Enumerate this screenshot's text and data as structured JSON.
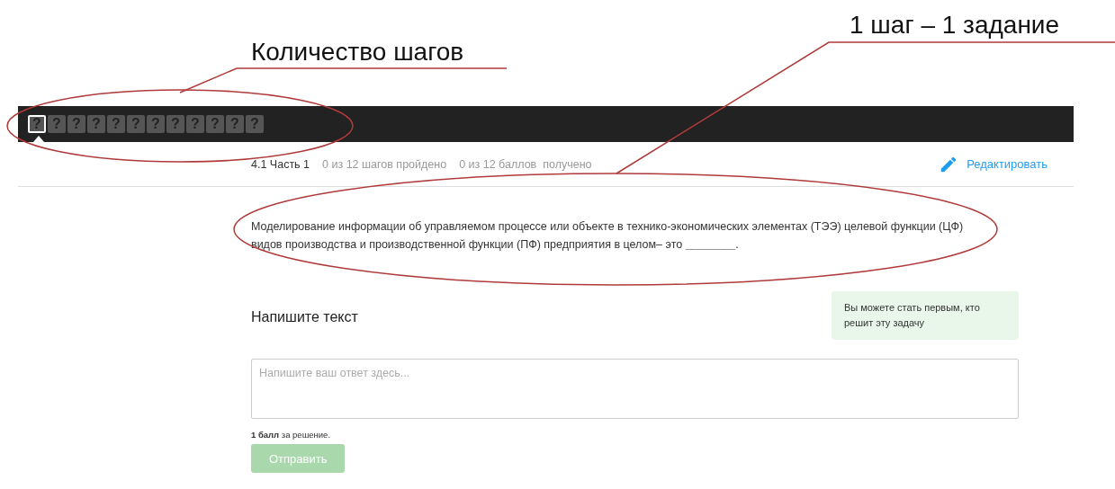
{
  "annotations": [
    {
      "text": "Количество шагов"
    },
    {
      "text": "1 шаг – 1 задание"
    }
  ],
  "steps": [
    {
      "label": "?",
      "selected": true
    },
    {
      "label": "?",
      "selected": false
    },
    {
      "label": "?",
      "selected": false
    },
    {
      "label": "?",
      "selected": false
    },
    {
      "label": "?",
      "selected": false
    },
    {
      "label": "?",
      "selected": false
    },
    {
      "label": "?",
      "selected": false
    },
    {
      "label": "?",
      "selected": false
    },
    {
      "label": "?",
      "selected": false
    },
    {
      "label": "?",
      "selected": false
    },
    {
      "label": "?",
      "selected": false
    },
    {
      "label": "?",
      "selected": false
    }
  ],
  "lesson": {
    "title": "4.1 Часть 1",
    "progress": "0 из 12 шагов пройдено",
    "score": "0 из 12 баллов  получено",
    "edit_button": "Редактировать"
  },
  "question": "Моделирование информации об управляемом процессе или объекте в технико-экономических элементах (ТЭЭ) целевой функции (ЦФ) видов производства и производственной функции (ПФ) предприятия в целом– это **________**.",
  "hint": "Вы можете стать первым, кто решит эту задачу",
  "answer": {
    "heading": "Напишите текст",
    "placeholder": "Напишите ваш ответ здесь..."
  },
  "points": "**1 балл** за решение.",
  "submit": {
    "label": "Отправить",
    "disabled": true
  }
}
